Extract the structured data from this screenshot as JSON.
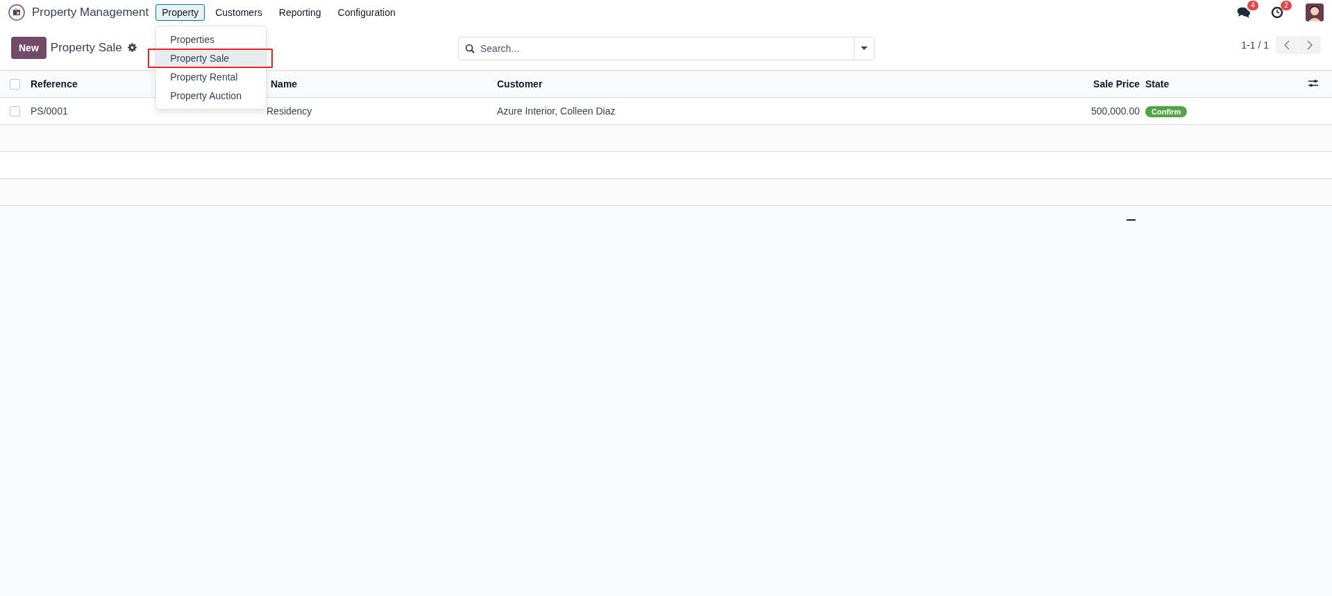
{
  "app": {
    "title": "Property Management"
  },
  "menu": [
    {
      "label": "Property",
      "expanded": true,
      "items": [
        {
          "label": "Properties",
          "selected": false,
          "outlined": false
        },
        {
          "label": "Property Sale",
          "selected": true,
          "outlined": true
        },
        {
          "label": "Property Rental",
          "selected": false,
          "outlined": false
        },
        {
          "label": "Property Auction",
          "selected": false,
          "outlined": false
        }
      ]
    },
    {
      "label": "Customers",
      "expanded": false
    },
    {
      "label": "Reporting",
      "expanded": false
    },
    {
      "label": "Configuration",
      "expanded": false
    }
  ],
  "systray": {
    "messages_badge": "4",
    "activities_badge": "2"
  },
  "control_panel": {
    "new_button": "New",
    "breadcrumb": "Property Sale",
    "search": {
      "placeholder": "Search..."
    },
    "pager": "1-1 / 1"
  },
  "table": {
    "select_all": {
      "checked": false
    },
    "columns": [
      {
        "label": "Reference"
      },
      {
        "label": "Name"
      },
      {
        "label": "Customer"
      },
      {
        "label": "Sale Price"
      },
      {
        "label": "State"
      }
    ],
    "rows": [
      {
        "checked": false,
        "reference": "PS/0001",
        "name": "Residency",
        "customer": "Azure Interior, Colleen Diaz",
        "sale_price": "500,000.00",
        "state": {
          "label": "Confirm",
          "color": "#54a445"
        }
      }
    ]
  }
}
